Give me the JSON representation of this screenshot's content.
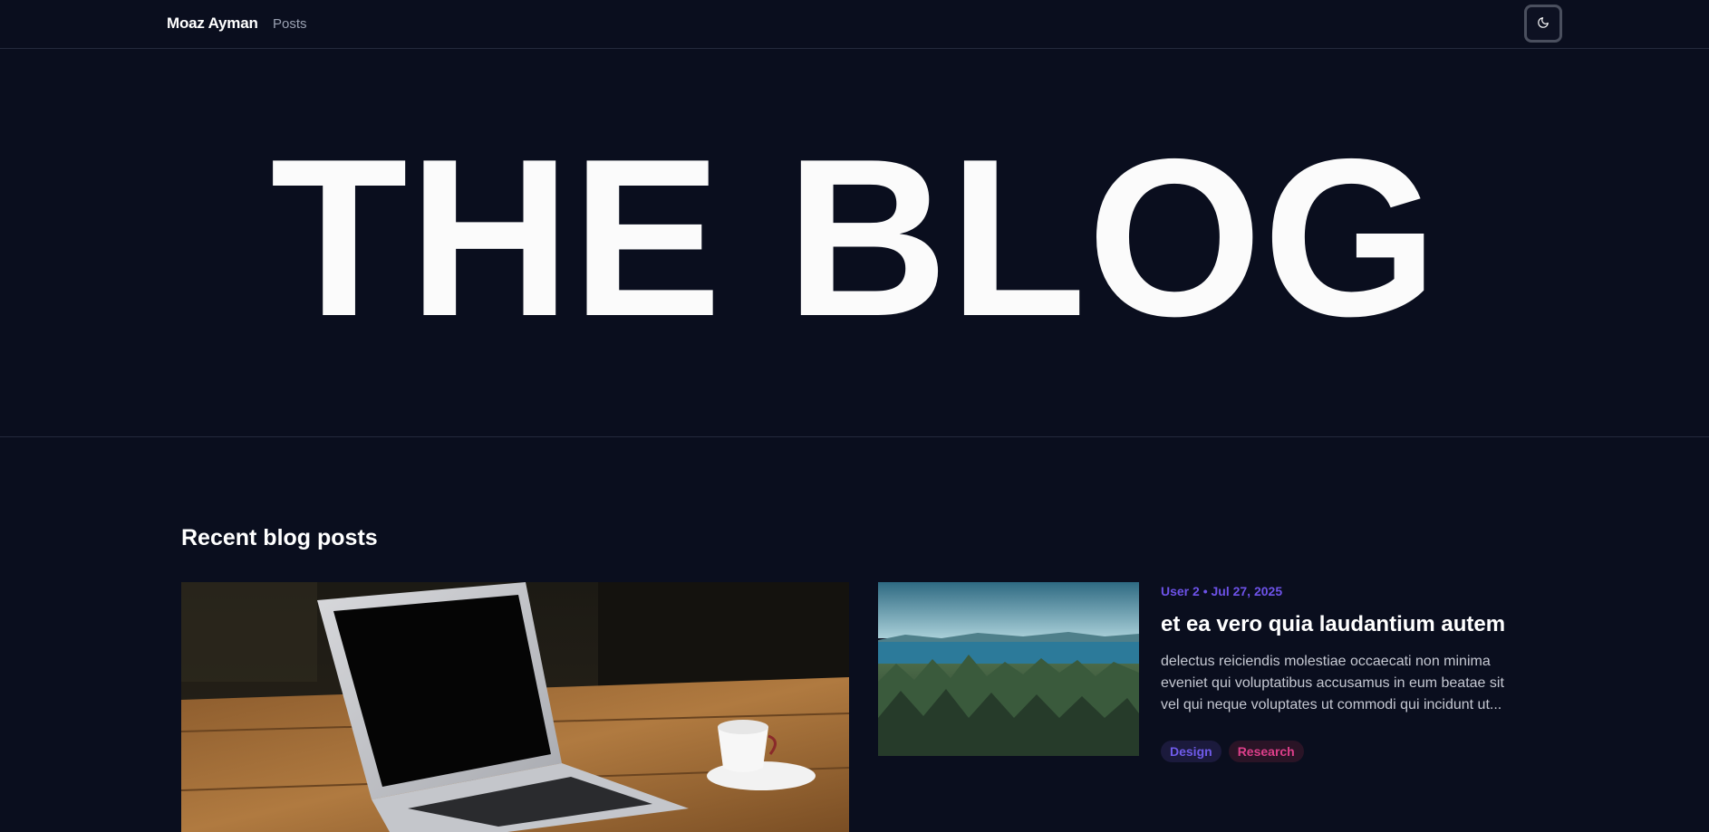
{
  "navbar": {
    "brand": "Moaz Ayman",
    "links": [
      {
        "label": "Posts"
      }
    ],
    "theme_toggle_icon": "moon-icon"
  },
  "hero": {
    "title": "THE BLOG"
  },
  "recent_posts": {
    "heading": "Recent blog posts",
    "featured": {
      "image": "laptop-coffee-photo"
    },
    "posts": [
      {
        "meta": "User 2 • Jul 27, 2025",
        "title": "et ea vero quia laudantium autem",
        "excerpt_lines": [
          "delectus reiciendis molestiae occaecati non minima",
          "eveniet qui voluptatibus accusamus in eum beatae sit",
          "vel qui neque voluptates ut commodi qui incidunt ut..."
        ],
        "image": "forest-lake-photo",
        "tags": [
          {
            "label": "Design",
            "color": "#6f5bea"
          },
          {
            "label": "Research",
            "color": "#dd3f8a"
          }
        ]
      }
    ]
  },
  "colors": {
    "background": "#0a0e1e",
    "accent": "#6d52e8",
    "border": "#242a3c"
  }
}
